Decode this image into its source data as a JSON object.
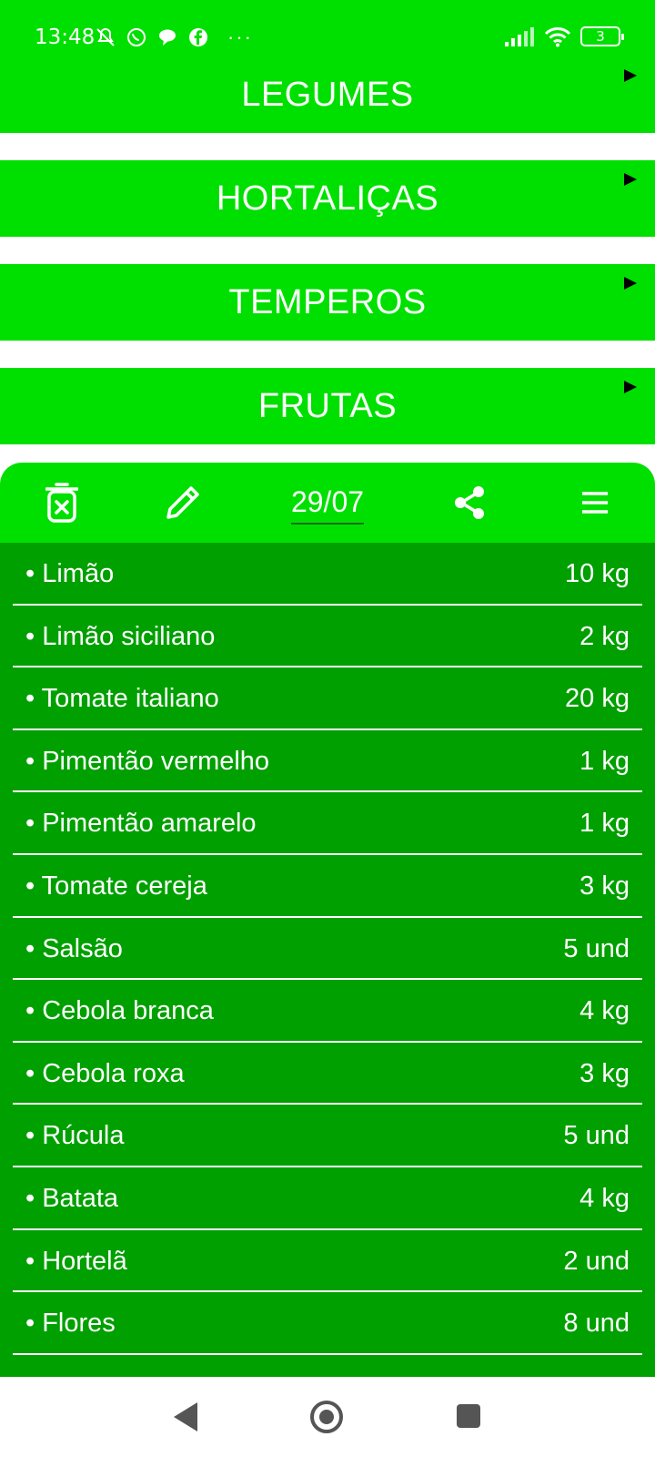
{
  "status_bar": {
    "time": "13:48",
    "battery": "3",
    "icons_left": [
      "mute-icon",
      "whatsapp-icon",
      "chat-icon",
      "facebook-icon"
    ],
    "overflow": "···"
  },
  "categories": [
    {
      "label": "LEGUMES"
    },
    {
      "label": "HORTALIÇAS"
    },
    {
      "label": "TEMPEROS"
    },
    {
      "label": "FRUTAS"
    }
  ],
  "toolbar": {
    "date": "29/07",
    "icons": [
      "trash-icon",
      "pencil-icon",
      "share-icon",
      "menu-icon"
    ]
  },
  "items": [
    {
      "name": "• Limão",
      "qty": "10 kg"
    },
    {
      "name": "• Limão siciliano",
      "qty": "2 kg"
    },
    {
      "name": "• Tomate italiano",
      "qty": "20 kg"
    },
    {
      "name": "• Pimentão vermelho",
      "qty": "1 kg"
    },
    {
      "name": "• Pimentão amarelo",
      "qty": "1 kg"
    },
    {
      "name": "• Tomate cereja",
      "qty": "3 kg"
    },
    {
      "name": "• Salsão",
      "qty": "5 und"
    },
    {
      "name": "• Cebola branca",
      "qty": "4 kg"
    },
    {
      "name": "• Cebola roxa",
      "qty": "3 kg"
    },
    {
      "name": "• Rúcula",
      "qty": "5 und"
    },
    {
      "name": "• Batata",
      "qty": "4 kg"
    },
    {
      "name": "• Hortelã",
      "qty": "2 und"
    },
    {
      "name": "• Flores",
      "qty": "8 und"
    }
  ],
  "colors": {
    "bright_green": "#00e000",
    "list_green": "#00a000",
    "text": "#ffffff"
  }
}
